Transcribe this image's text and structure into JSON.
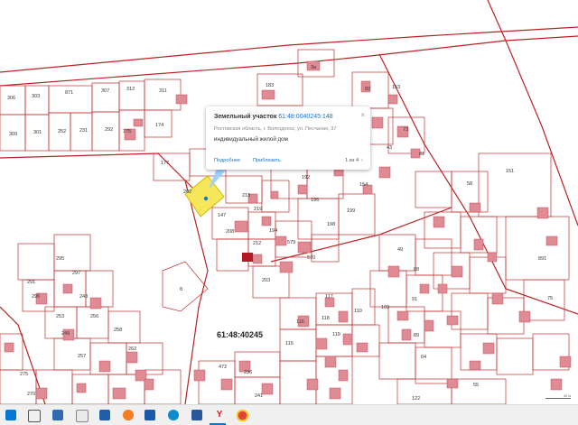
{
  "map": {
    "plots_top": [
      "306",
      "303",
      "871",
      "307",
      "312",
      "311",
      "309",
      "301",
      "252",
      "231",
      "292",
      "175",
      "174",
      "177",
      "183",
      "82",
      "153",
      "3а"
    ],
    "plots_mid": [
      "202",
      "213",
      "147",
      "219",
      "192",
      "196",
      "198",
      "199",
      "154",
      "73",
      "81",
      "151",
      "43",
      "58",
      "212",
      "208",
      "194",
      "579",
      "570",
      "203",
      "49",
      "891",
      "88"
    ],
    "plots_low": [
      "295",
      "297",
      "291",
      "296",
      "248",
      "253",
      "256",
      "249",
      "258",
      "262",
      "257",
      "275",
      "270",
      "8",
      "117",
      "116",
      "115",
      "118",
      "119",
      "110",
      "109",
      "89",
      "91",
      "64",
      "75",
      "472",
      "236",
      "241",
      "122",
      "55"
    ],
    "region_label": "61:48:40245",
    "selected_plot": "148"
  },
  "popup": {
    "title": "Земельный участок",
    "cad_number": "61:48:0040245:148",
    "address": "Ростовская область, г. Волгодонск, ул. Песчаная, 37",
    "use": "индивидуальный жилой дом",
    "details_link": "Подробнее",
    "zoom_link": "Приблизить",
    "pager": "1 из 4",
    "close": "×",
    "next": "›"
  },
  "scale_label": "40 м",
  "taskbar": {
    "icons": [
      "start-icon",
      "search-icon",
      "task-view-icon",
      "mail-icon",
      "browser-icon",
      "store-icon",
      "edge-icon",
      "word-icon",
      "yandex-icon",
      "chrome-icon"
    ]
  }
}
